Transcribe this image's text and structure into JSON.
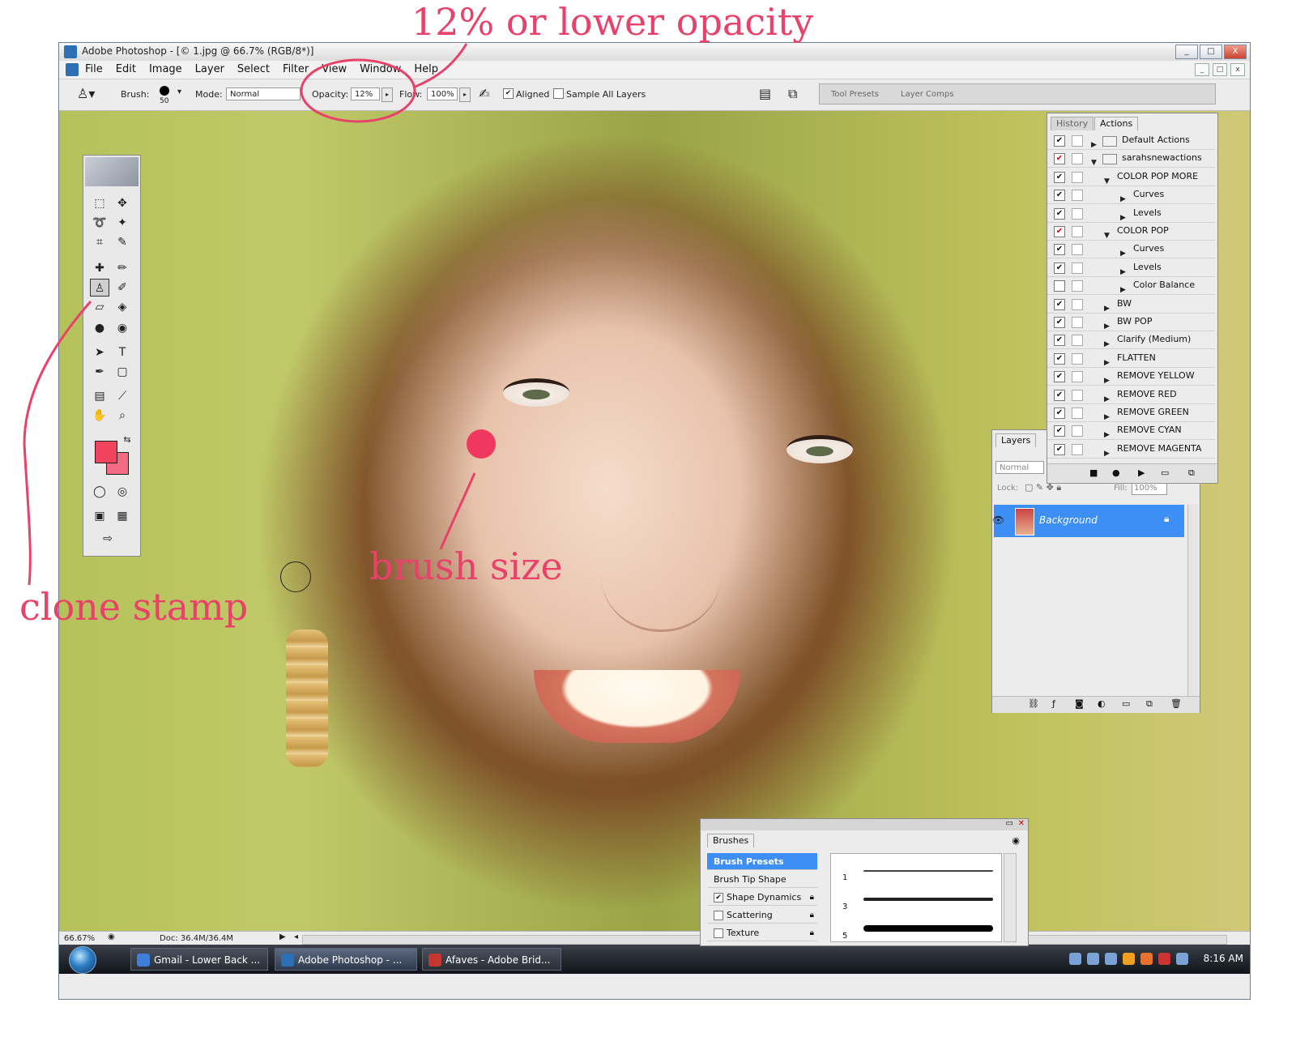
{
  "annotations": {
    "opacity_note": "12% or lower opacity",
    "clone_stamp_note": "clone stamp",
    "brush_size_note": "brush size"
  },
  "window": {
    "title": "Adobe Photoshop - [© 1.jpg @ 66.7% (RGB/8*)]",
    "controls": [
      "_",
      "□",
      "X"
    ],
    "doc_controls": [
      "_",
      "□",
      "x"
    ]
  },
  "menu": [
    "File",
    "Edit",
    "Image",
    "Layer",
    "Select",
    "Filter",
    "View",
    "Window",
    "Help"
  ],
  "options_bar": {
    "brush_label": "Brush:",
    "brush_size": "50",
    "mode_label": "Mode:",
    "mode_value": "Normal",
    "opacity_label": "Opacity:",
    "opacity_value": "12%",
    "flow_label": "Flow:",
    "flow_value": "100%",
    "aligned_label": "Aligned",
    "aligned_checked": true,
    "sample_all_label": "Sample All Layers",
    "sample_all_checked": false,
    "well_tabs": [
      "Tool Presets",
      "Layer Comps"
    ]
  },
  "toolbox": {
    "selected_tool": "clone-stamp",
    "foreground_color": "#f2435e",
    "background_color": "#f26b83"
  },
  "actions_panel": {
    "tabs": [
      "History",
      "Actions"
    ],
    "active_tab": "Actions",
    "rows": [
      {
        "label": "Default Actions",
        "type": "set",
        "expanded": false,
        "check": "✔",
        "red": false
      },
      {
        "label": "sarahsnewactions",
        "type": "set",
        "expanded": true,
        "check": "✔",
        "red": true
      },
      {
        "label": "COLOR POP MORE",
        "type": "action",
        "expanded": true,
        "check": "✔",
        "red": false
      },
      {
        "label": "Curves",
        "type": "step",
        "expanded": false,
        "check": "✔",
        "red": false
      },
      {
        "label": "Levels",
        "type": "step",
        "expanded": false,
        "check": "✔",
        "red": false
      },
      {
        "label": "COLOR POP",
        "type": "action",
        "expanded": true,
        "check": "✔",
        "red": true
      },
      {
        "label": "Curves",
        "type": "step",
        "expanded": false,
        "check": "✔",
        "red": false
      },
      {
        "label": "Levels",
        "type": "step",
        "expanded": false,
        "check": "✔",
        "red": false
      },
      {
        "label": "Color Balance",
        "type": "step",
        "expanded": false,
        "check": "",
        "red": false
      },
      {
        "label": "BW",
        "type": "action",
        "expanded": false,
        "check": "✔",
        "red": false
      },
      {
        "label": "BW POP",
        "type": "action",
        "expanded": false,
        "check": "✔",
        "red": false
      },
      {
        "label": "Clarify (Medium)",
        "type": "action",
        "expanded": false,
        "check": "✔",
        "red": false
      },
      {
        "label": "FLATTEN",
        "type": "action",
        "expanded": false,
        "check": "✔",
        "red": false
      },
      {
        "label": "REMOVE YELLOW",
        "type": "action",
        "expanded": false,
        "check": "✔",
        "red": false
      },
      {
        "label": "REMOVE RED",
        "type": "action",
        "expanded": false,
        "check": "✔",
        "red": false
      },
      {
        "label": "REMOVE GREEN",
        "type": "action",
        "expanded": false,
        "check": "✔",
        "red": false
      },
      {
        "label": "REMOVE CYAN",
        "type": "action",
        "expanded": false,
        "check": "✔",
        "red": false
      },
      {
        "label": "REMOVE MAGENTA",
        "type": "action",
        "expanded": false,
        "check": "✔",
        "red": false
      }
    ]
  },
  "layers_panel": {
    "tab": "Layers",
    "blend_mode": "Normal",
    "lock_label": "Lock:",
    "fill_label": "Fill:",
    "fill_value": "100%",
    "layer_name": "Background"
  },
  "brushes_panel": {
    "tab": "Brushes",
    "items": [
      {
        "label": "Brush Presets",
        "active": true,
        "checkbox": false,
        "checked": false
      },
      {
        "label": "Brush Tip Shape",
        "active": false,
        "checkbox": false,
        "checked": false
      },
      {
        "label": "Shape Dynamics",
        "active": false,
        "checkbox": true,
        "checked": true
      },
      {
        "label": "Scattering",
        "active": false,
        "checkbox": true,
        "checked": false
      },
      {
        "label": "Texture",
        "active": false,
        "checkbox": true,
        "checked": false
      }
    ],
    "preset_sizes": [
      "1",
      "3",
      "5"
    ]
  },
  "status": {
    "zoom": "66.67%",
    "doc": "Doc: 36.4M/36.4M"
  },
  "taskbar": {
    "items": [
      {
        "label": "Gmail - Lower Back ...",
        "active": false,
        "color": "#3d7fd9"
      },
      {
        "label": "Adobe Photoshop - ...",
        "active": true,
        "color": "#2d6fb5"
      },
      {
        "label": "Afaves - Adobe Brid...",
        "active": false,
        "color": "#c4362e"
      }
    ],
    "clock": "8:16 AM"
  }
}
